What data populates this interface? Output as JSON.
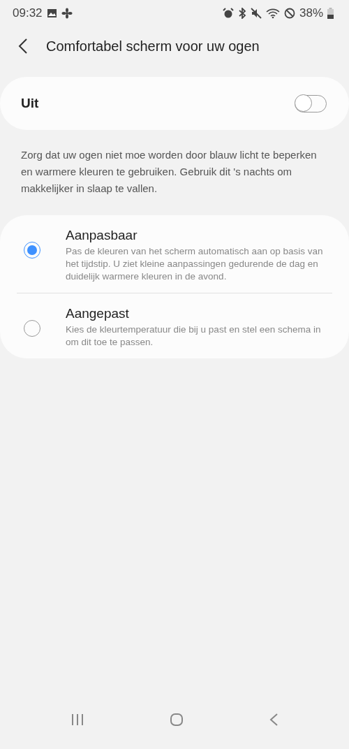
{
  "status_bar": {
    "time": "09:32",
    "battery": "38%"
  },
  "header": {
    "title": "Comfortabel scherm voor uw ogen"
  },
  "master_switch": {
    "label": "Uit",
    "on": false
  },
  "description": "Zorg dat uw ogen niet moe worden door blauw licht te beperken en warmere kleuren te gebruiken. Gebruik dit 's nachts om makkelijker in slaap te vallen.",
  "options": [
    {
      "title": "Aanpasbaar",
      "summary": "Pas de kleuren van het scherm automatisch aan op basis van het tijdstip. U ziet kleine aanpassingen gedurende de dag en duidelijk warmere kleuren in de avond.",
      "selected": true
    },
    {
      "title": "Aangepast",
      "summary": "Kies de kleurtemperatuur die bij u past en stel een schema in om dit toe te passen.",
      "selected": false
    }
  ]
}
